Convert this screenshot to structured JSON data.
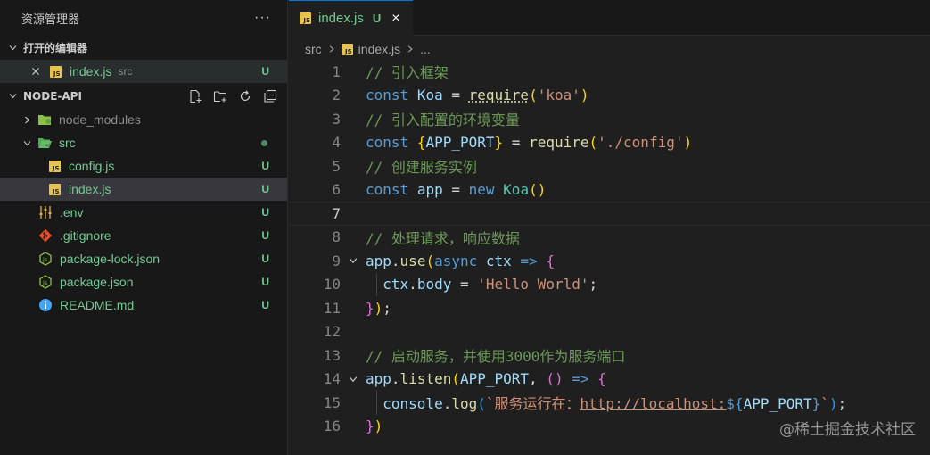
{
  "sidebar": {
    "title": "资源管理器",
    "more": "···",
    "open_editors": {
      "label": "打开的编辑器",
      "items": [
        {
          "name": "index.js",
          "desc": "src",
          "status": "U"
        }
      ]
    },
    "project": {
      "label": "NODE-API",
      "actions": [
        "new-file-icon",
        "new-folder-icon",
        "refresh-icon",
        "collapse-all-icon"
      ],
      "items": [
        {
          "name": "node_modules",
          "type": "folder-closed",
          "status": ""
        },
        {
          "name": "src",
          "type": "folder-open",
          "status": "dot"
        },
        {
          "name": "config.js",
          "type": "js",
          "status": "U"
        },
        {
          "name": "index.js",
          "type": "js",
          "status": "U"
        },
        {
          "name": ".env",
          "type": "env",
          "status": "U"
        },
        {
          "name": ".gitignore",
          "type": "git",
          "status": "U"
        },
        {
          "name": "package-lock.json",
          "type": "node",
          "status": "U"
        },
        {
          "name": "package.json",
          "type": "node",
          "status": "U"
        },
        {
          "name": "README.md",
          "type": "info",
          "status": "U"
        }
      ]
    }
  },
  "editor": {
    "tab": {
      "label": "index.js",
      "status": "U",
      "close": "×"
    },
    "breadcrumb": [
      "src",
      "index.js",
      "..."
    ],
    "lines": [
      {
        "n": "1"
      },
      {
        "n": "2"
      },
      {
        "n": "3"
      },
      {
        "n": "4"
      },
      {
        "n": "5"
      },
      {
        "n": "6"
      },
      {
        "n": "7"
      },
      {
        "n": "8"
      },
      {
        "n": "9"
      },
      {
        "n": "10"
      },
      {
        "n": "11"
      },
      {
        "n": "12"
      },
      {
        "n": "13"
      },
      {
        "n": "14"
      },
      {
        "n": "15"
      },
      {
        "n": "16"
      }
    ],
    "code": {
      "l1_comment": "// 引入框架",
      "l2_kw": "const",
      "l2_var": "Koa",
      "l2_eq": " = ",
      "l2_fn": "require",
      "l2_str": "'koa'",
      "l3_comment": "// 引入配置的环境变量",
      "l4_kw": "const",
      "l4_var": "APP_PORT",
      "l4_eq": " = ",
      "l4_fn": "require",
      "l4_str": "'./config'",
      "l5_comment": "// 创建服务实例",
      "l6_kw": "const",
      "l6_var": "app",
      "l6_eq": " = ",
      "l6_new": "new",
      "l6_cls": "Koa",
      "l8_comment": "// 处理请求，响应数据",
      "l9_var": "app",
      "l9_fn": "use",
      "l9_async": "async",
      "l9_param": "ctx",
      "l9_arrow": "=>",
      "l10_var1": "ctx",
      "l10_var2": "body",
      "l10_eq": " = ",
      "l10_str": "'Hello World'",
      "l10_semi": ";",
      "l11_semi": ";",
      "l13_comment": "// 启动服务，并使用3000作为服务端口",
      "l14_var": "app",
      "l14_fn": "listen",
      "l14_arg": "APP_PORT",
      "l14_comma": ", ",
      "l14_arrow": "=>",
      "l15_var": "console",
      "l15_fn": "log",
      "l15_str1": "`服务运行在：",
      "l15_url": "http://localhost:",
      "l15_interp_open": "${",
      "l15_interp_var": "APP_PORT",
      "l15_interp_close": "}",
      "l15_str2": "`",
      "l15_semi": ";"
    }
  },
  "watermark": "@稀土掘金技术社区",
  "colors": {
    "git_untracked": "#73c991",
    "comment": "#6a9955",
    "keyword": "#569cd6",
    "string": "#ce9178",
    "function": "#dcdcaa",
    "variable": "#9cdcfe",
    "accent": "#0078d4"
  }
}
